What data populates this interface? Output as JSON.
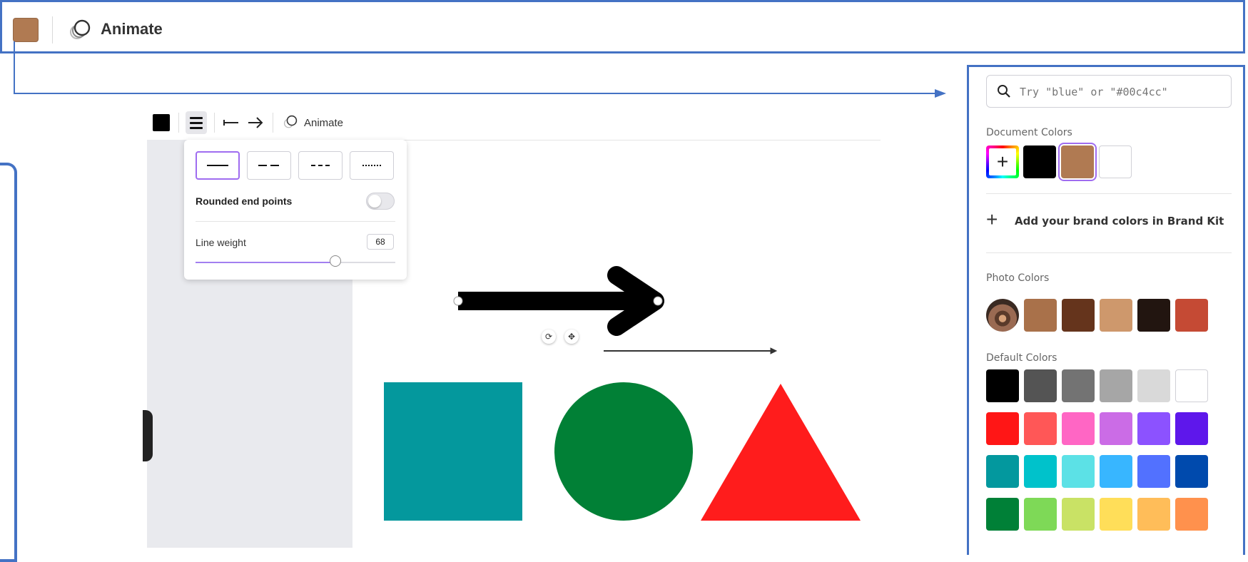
{
  "top_toolbar": {
    "swatch_color": "#b07a52",
    "animate_label": "Animate",
    "animate_icon": "animate-icon"
  },
  "inner_toolbar": {
    "color_swatch": "#000000",
    "line_style_icon": "line-style-icon",
    "start_icon": "line-start-icon",
    "end_icon": "arrow-end-icon",
    "animate_label": "Animate"
  },
  "line_style_popup": {
    "styles": [
      "solid",
      "long-dash",
      "short-dash",
      "dotted"
    ],
    "selected_style": "solid",
    "rounded_label": "Rounded end points",
    "rounded_on": false,
    "weight_label": "Line weight",
    "weight_value": "68",
    "weight_fraction": 0.7
  },
  "canvas": {
    "shapes": [
      {
        "kind": "arrow",
        "color": "#000000"
      },
      {
        "kind": "thin-arrow",
        "color": "#333333"
      },
      {
        "kind": "square",
        "color": "#04989d"
      },
      {
        "kind": "circle",
        "color": "#018036"
      },
      {
        "kind": "triangle",
        "color": "#ff1c1c"
      }
    ],
    "handles": [
      "rotate-icon",
      "move-icon"
    ]
  },
  "color_panel": {
    "search_placeholder": "Try \"blue\" or \"#00c4cc\"",
    "document_colors_label": "Document Colors",
    "document_colors": [
      "#000000",
      "#b07a52",
      "#ffffff"
    ],
    "selected_document_color": "#b07a52",
    "brand_kit_label": "Add your brand colors in Brand Kit",
    "photo_colors_label": "Photo Colors",
    "photo_colors": [
      "#a9714a",
      "#65341c",
      "#ce986c",
      "#221510",
      "#c54a34"
    ],
    "default_colors_label": "Default Colors",
    "default_colors": [
      [
        "#000000",
        "#545454",
        "#737373",
        "#a6a6a6",
        "#d9d9d9",
        "#ffffff"
      ],
      [
        "#ff1616",
        "#ff5757",
        "#ff66c4",
        "#cb6ce6",
        "#8c52ff",
        "#5e17eb"
      ],
      [
        "#03989e",
        "#00c2cb",
        "#5ce1e6",
        "#38b6ff",
        "#5271ff",
        "#004aad"
      ],
      [
        "#008037",
        "#7ed957",
        "#c9e265",
        "#ffde59",
        "#ffbd59",
        "#ff914d"
      ]
    ]
  }
}
